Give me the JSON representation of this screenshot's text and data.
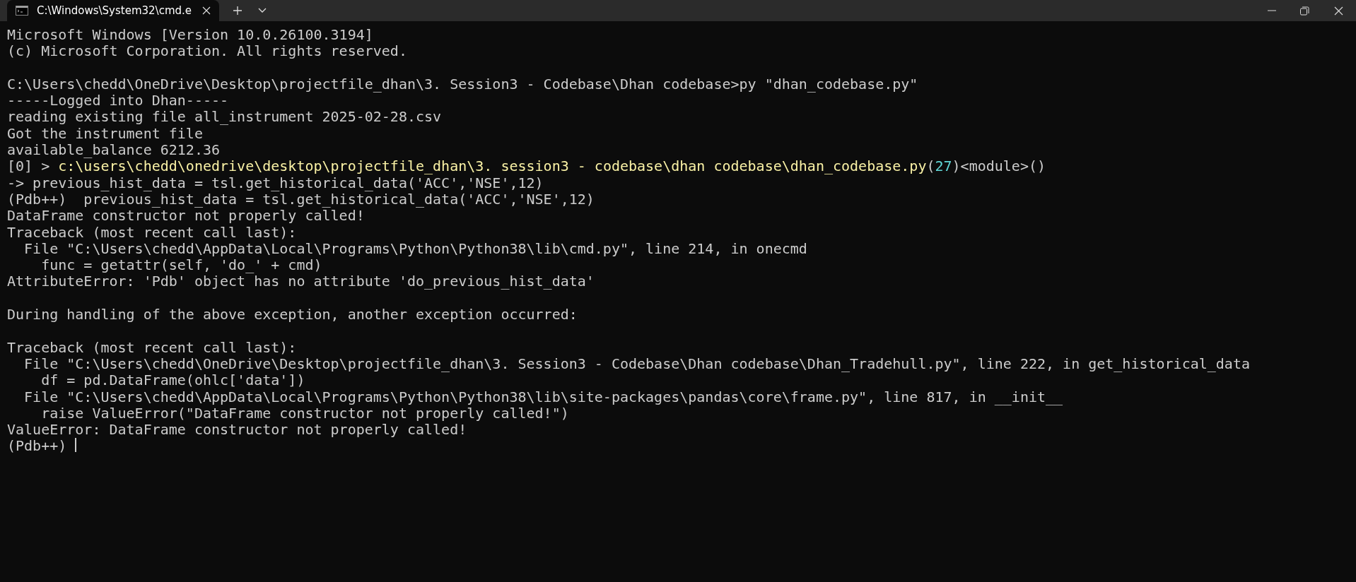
{
  "window": {
    "tab_title": "C:\\Windows\\System32\\cmd.e",
    "tab_selected": true
  },
  "lines": [
    {
      "segments": [
        {
          "kind": "plain",
          "text": "Microsoft Windows [Version 10.0.26100.3194]"
        }
      ]
    },
    {
      "segments": [
        {
          "kind": "plain",
          "text": "(c) Microsoft Corporation. All rights reserved."
        }
      ],
      "blank_line_after": true
    },
    {
      "segments": [
        {
          "kind": "plain",
          "text": "C:\\Users\\chedd\\OneDrive\\Desktop\\projectfile_dhan\\3. Session3 - Codebase\\Dhan codebase>py \"dhan_codebase.py\""
        }
      ]
    },
    {
      "segments": [
        {
          "kind": "plain",
          "text": "-----Logged into Dhan-----"
        }
      ]
    },
    {
      "segments": [
        {
          "kind": "plain",
          "text": "reading existing file all_instrument 2025-02-28.csv"
        }
      ]
    },
    {
      "segments": [
        {
          "kind": "plain",
          "text": "Got the instrument file"
        }
      ]
    },
    {
      "segments": [
        {
          "kind": "plain",
          "text": "available_balance 6212.36"
        }
      ]
    },
    {
      "segments": [
        {
          "kind": "plain",
          "text": "[0] > "
        },
        {
          "kind": "path",
          "text": "c:\\users\\chedd\\onedrive\\desktop\\projectfile_dhan\\3. session3 - codebase\\dhan codebase\\dhan_codebase.py"
        },
        {
          "kind": "plain",
          "text": "("
        },
        {
          "kind": "number",
          "text": "27"
        },
        {
          "kind": "plain",
          "text": ")<module>()"
        }
      ]
    },
    {
      "segments": [
        {
          "kind": "plain",
          "text": "-> previous_hist_data = tsl.get_historical_data('ACC','NSE',12)"
        }
      ]
    },
    {
      "segments": [
        {
          "kind": "plain",
          "text": "(Pdb++)  previous_hist_data = tsl.get_historical_data('ACC','NSE',12)"
        }
      ]
    },
    {
      "segments": [
        {
          "kind": "plain",
          "text": "DataFrame constructor not properly called!"
        }
      ]
    },
    {
      "segments": [
        {
          "kind": "plain",
          "text": "Traceback (most recent call last):"
        }
      ]
    },
    {
      "segments": [
        {
          "kind": "plain",
          "text": "  File \"C:\\Users\\chedd\\AppData\\Local\\Programs\\Python\\Python38\\lib\\cmd.py\", line 214, in onecmd"
        }
      ]
    },
    {
      "segments": [
        {
          "kind": "plain",
          "text": "    func = getattr(self, 'do_' + cmd)"
        }
      ]
    },
    {
      "segments": [
        {
          "kind": "plain",
          "text": "AttributeError: 'Pdb' object has no attribute 'do_previous_hist_data'"
        }
      ],
      "blank_line_after": true
    },
    {
      "segments": [
        {
          "kind": "plain",
          "text": "During handling of the above exception, another exception occurred:"
        }
      ],
      "blank_line_after": true
    },
    {
      "segments": [
        {
          "kind": "plain",
          "text": "Traceback (most recent call last):"
        }
      ]
    },
    {
      "segments": [
        {
          "kind": "plain",
          "text": "  File \"C:\\Users\\chedd\\OneDrive\\Desktop\\projectfile_dhan\\3. Session3 - Codebase\\Dhan codebase\\Dhan_Tradehull.py\", line 222, in get_historical_data"
        }
      ]
    },
    {
      "segments": [
        {
          "kind": "plain",
          "text": "    df = pd.DataFrame(ohlc['data'])"
        }
      ]
    },
    {
      "segments": [
        {
          "kind": "plain",
          "text": "  File \"C:\\Users\\chedd\\AppData\\Local\\Programs\\Python\\Python38\\lib\\site-packages\\pandas\\core\\frame.py\", line 817, in __init__"
        }
      ]
    },
    {
      "segments": [
        {
          "kind": "plain",
          "text": "    raise ValueError(\"DataFrame constructor not properly called!\")"
        }
      ]
    },
    {
      "segments": [
        {
          "kind": "plain",
          "text": "ValueError: DataFrame constructor not properly called!"
        }
      ]
    },
    {
      "segments": [
        {
          "kind": "plain",
          "text": "(Pdb++) "
        }
      ],
      "cursor": true
    }
  ]
}
